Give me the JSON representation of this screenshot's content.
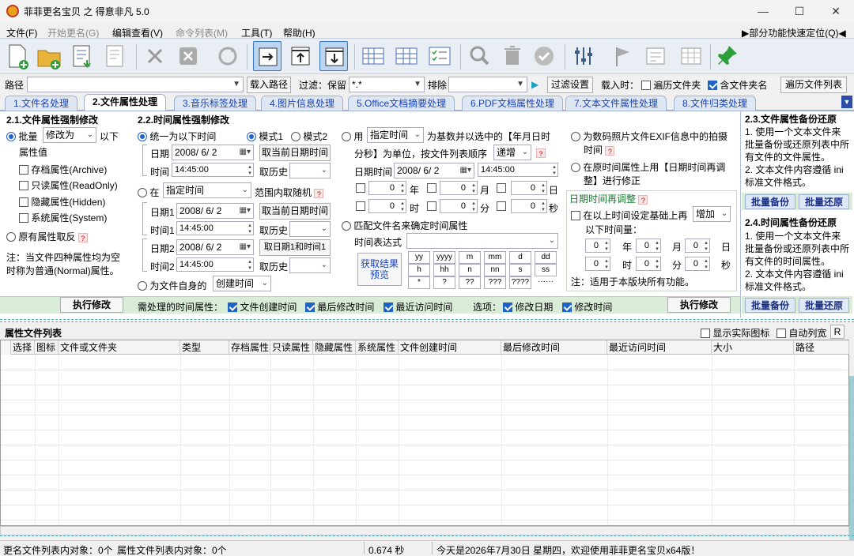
{
  "window": {
    "title": "菲菲更名宝贝 之 得意非凡 5.0",
    "min": "—",
    "max": "☐",
    "close": "✕"
  },
  "menu": {
    "file": "文件(F)",
    "start": "开始更名(G)",
    "edit": "编辑查看(V)",
    "cmdlist": "命令列表(M)",
    "tools": "工具(T)",
    "help": "帮助(H)",
    "locate": "▶部分功能快速定位(Q)◀"
  },
  "pathbar": {
    "path_label": "路径",
    "load_path": "载入路径",
    "filter_label": "过滤：保留",
    "filter_value": "*.*",
    "exclude_label": "排除",
    "filter_settings": "过滤设置",
    "load_time_label": "载入时：",
    "traverse_folder": "遍历文件夹",
    "include_folder_name": "含文件夹名",
    "traverse_list": "遍历文件列表"
  },
  "tabs": [
    "1.文件名处理",
    "2.文件属性处理",
    "3.音乐标签处理",
    "4.图片信息处理",
    "5.Office文档摘要处理",
    "6.PDF文档属性处理",
    "7.文本文件属性处理",
    "8.文件归类处理"
  ],
  "attr": {
    "title": "2.1.文件属性强制修改",
    "batch": "批量",
    "modify_to": "修改为",
    "below": "以下",
    "attr_value": "属性值",
    "archive": "存档属性(Archive)",
    "readonly": "只读属性(ReadOnly)",
    "hidden": "隐藏属性(Hidden)",
    "system": "系统属性(System)",
    "invert": "原有属性取反",
    "help": "?",
    "note": "注：当文件四种属性均为空时称为普通(Normal)属性。",
    "exec": "执行修改"
  },
  "time": {
    "title": "2.2.时间属性强制修改",
    "unified": "统一为以下时间",
    "mode1": "模式1",
    "mode2": "模式2",
    "date_label": "日期",
    "date_value": "2008/ 6/ 2",
    "get_current_date": "取当前日期时间",
    "time_label": "时间",
    "time_value": "14:45:00",
    "history": "取历史",
    "in_label": "在",
    "specified_time": "指定时间",
    "range_random": "范围内取随机",
    "date1": "日期1",
    "date1_value": "2008/ 6/ 2",
    "time1": "时间1",
    "time1_value": "14:45:00",
    "date2": "日期2",
    "date2_value": "2008/ 6/ 2",
    "time2": "时间2",
    "time2_value": "14:45:00",
    "get_date1_time1": "取日期1和时间1",
    "self_label": "为文件自身的",
    "self_value": "创建时间",
    "use_label": "用",
    "use_value": "指定时间",
    "base_text1": "为基数并以选中的【年月日时",
    "base_text2": "分秒】为单位，按文件列表顺序",
    "order": "递增",
    "datetime_label": "日期时间",
    "dt_date": "2008/ 6/ 2",
    "dt_time": "14:45:00",
    "year": "年",
    "month": "月",
    "day": "日",
    "hour": "时",
    "minute": "分",
    "second": "秒",
    "zero": "0",
    "match": "匹配文件名来确定时间属性",
    "expr_label": "时间表达式",
    "preview": "获取结果预览",
    "tokens": [
      "yy",
      "yyyy",
      "m",
      "mm",
      "d",
      "dd",
      "h",
      "hh",
      "n",
      "nn",
      "s",
      "ss",
      "*",
      "?",
      "??",
      "???",
      "????",
      "······"
    ],
    "need_label": "需处理的时间属性：",
    "created": "文件创建时间",
    "modified": "最后修改时间",
    "accessed": "最近访问时间",
    "options_label": "选项：",
    "mod_date": "修改日期",
    "mod_time": "修改时间",
    "exec": "执行修改"
  },
  "exif": {
    "exif_text1": "为数码照片文件EXIF信息中的拍摄",
    "exif_text2": "时间",
    "orig_text1": "在原时间属性上用【日期时间再调",
    "orig_text2": "整】进行修正",
    "adjust_title": "日期时间再调整",
    "base_text": "在以上时间设定基础上再",
    "increase": "增加",
    "below_time": "以下时间量：",
    "note": "注：适用于本版块所有功能。"
  },
  "backup": {
    "title1": "2.3.文件属性备份还原",
    "text1a": "1. 使用一个文本文件来批量备份或还原列表中所有文件的文件属性。",
    "text1b": "2. 文本文件内容遵循 ini 标准文件格式。",
    "title2": "2.4.时间属性备份还原",
    "text2a": "1. 使用一个文本文件来批量备份或还原列表中所有文件的时间属性。",
    "text2b": "2. 文本文件内容遵循 ini 标准文件格式。",
    "backup": "批量备份",
    "restore": "批量还原"
  },
  "list": {
    "title": "属性文件列表",
    "show_icon": "显示实际图标",
    "auto_width": "自动列宽",
    "r": "R",
    "columns": [
      "选择",
      "图标",
      "文件或文件夹",
      "类型",
      "存档属性",
      "只读属性",
      "隐藏属性",
      "系统属性",
      "文件创建时间",
      "最后修改时间",
      "最近访问时间",
      "大小",
      "路径"
    ]
  },
  "status": {
    "rename_count": "更名文件列表内对象：0个",
    "attr_count": "属性文件列表内对象：0个",
    "elapsed": "0.674 秒",
    "message": "今天是2026年7月30日 星期四，欢迎使用菲菲更名宝贝x64版！"
  }
}
